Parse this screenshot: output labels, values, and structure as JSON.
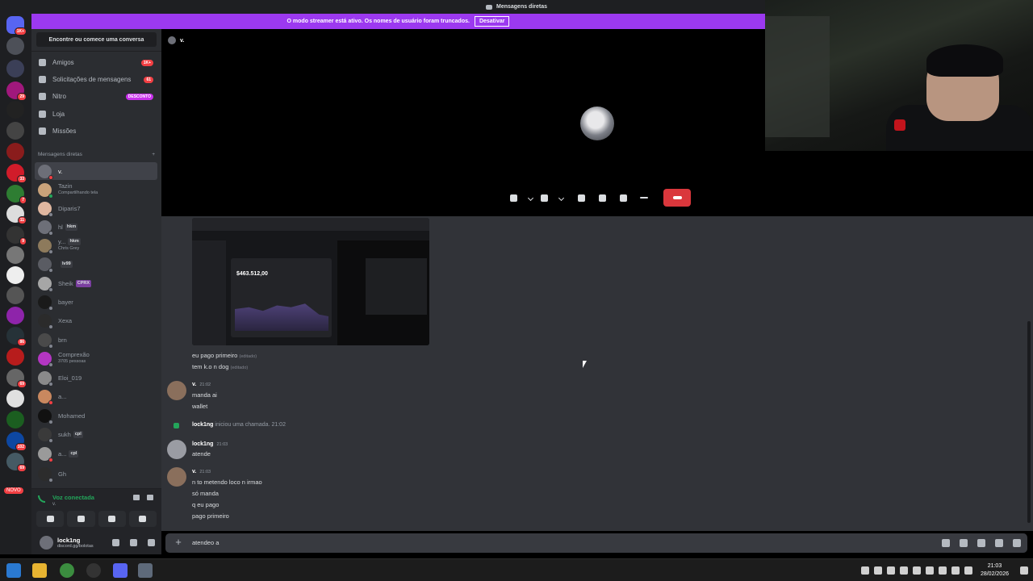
{
  "titlebar": {
    "title": "Mensagens diretas"
  },
  "streamer": {
    "text": "O modo streamer está ativo. Os nomes de usuário foram truncados.",
    "button": "Desativar"
  },
  "rail": {
    "top_badge": "1K+",
    "badges": [
      "29",
      "33",
      "7",
      "11",
      "9",
      "86",
      "69",
      "102",
      "69",
      "2",
      "3"
    ],
    "new_label": "NOVO"
  },
  "sidebar": {
    "search": "Encontre ou comece uma conversa",
    "nav": [
      {
        "label": "Amigos",
        "badge": "1K+",
        "icon": "friends-icon"
      },
      {
        "label": "Solicitações de mensagens",
        "badge": "61",
        "icon": "mail-icon"
      },
      {
        "label": "Nitro",
        "badge": "DESCONTO",
        "icon": "nitro-icon"
      },
      {
        "label": "Loja",
        "badge": "",
        "icon": "shop-icon"
      },
      {
        "label": "Missões",
        "badge": "",
        "icon": "quests-icon"
      }
    ],
    "dm_header": "Mensagens diretas",
    "dm_add": "+",
    "dms": [
      {
        "name": "v.",
        "sub": "",
        "tag": "",
        "status": "dnd"
      },
      {
        "name": "Tazin",
        "sub": "Compartilhando tela",
        "tag": "",
        "status": "on"
      },
      {
        "name": "Diparis7",
        "sub": "",
        "tag": "",
        "status": "off"
      },
      {
        "name": "hl",
        "sub": "",
        "tag": "hkm",
        "status": "off"
      },
      {
        "name": "y...",
        "sub": "Chris Grey",
        "tag": "hkm",
        "status": "off"
      },
      {
        "name": "",
        "sub": "",
        "tag": "Iv99",
        "status": "off"
      },
      {
        "name": "Sheik",
        "sub": "",
        "tag": "CPRX",
        "status": "off"
      },
      {
        "name": "bayer",
        "sub": "",
        "tag": "",
        "status": "off"
      },
      {
        "name": "Xexa",
        "sub": "",
        "tag": "",
        "status": "off"
      },
      {
        "name": "brn",
        "sub": "",
        "tag": "",
        "status": "off"
      },
      {
        "name": "Comprexão",
        "sub": "3705 pessoas",
        "tag": "",
        "status": "off"
      },
      {
        "name": "Eloi_019",
        "sub": "",
        "tag": "",
        "status": "off"
      },
      {
        "name": "a...",
        "sub": "",
        "tag": "",
        "status": "off"
      },
      {
        "name": "Mohamed",
        "sub": "",
        "tag": "",
        "status": "off"
      },
      {
        "name": "sukh",
        "sub": "",
        "tag": "cpl",
        "status": "off"
      },
      {
        "name": "a...",
        "sub": "",
        "tag": "cpl",
        "status": "off"
      },
      {
        "name": "Gh",
        "sub": "",
        "tag": "",
        "status": "off"
      }
    ],
    "voice": {
      "status": "Voz conectada",
      "channel": "v."
    },
    "user": {
      "name": "lock1ng",
      "status": "discord.gg/bolotas"
    }
  },
  "call": {
    "name": "v."
  },
  "chat": {
    "embed_value": "$463.512,00",
    "lines_top": [
      {
        "text": "eu pago primeiro",
        "edited": "(editado)"
      },
      {
        "text": "tem k.o n dog",
        "edited": "(editado)"
      }
    ],
    "groups": [
      {
        "author": "v.",
        "time": "21:02",
        "lines": [
          "manda ai",
          "wallet"
        ]
      },
      {
        "author": "lock1ng",
        "time": "21:03",
        "lines": [
          "atende"
        ]
      },
      {
        "author": "v.",
        "time": "21:03",
        "lines": [
          "n to metendo loco n irmao",
          "só manda",
          "q eu pago",
          "pago primeiro"
        ]
      }
    ],
    "system": {
      "who": "lock1ng",
      "text": "iniciou uma chamada.",
      "time": "21:02"
    }
  },
  "composer": {
    "value": "atendeo a"
  },
  "taskbar": {
    "time": "21:03",
    "date": "28/02/2026"
  }
}
